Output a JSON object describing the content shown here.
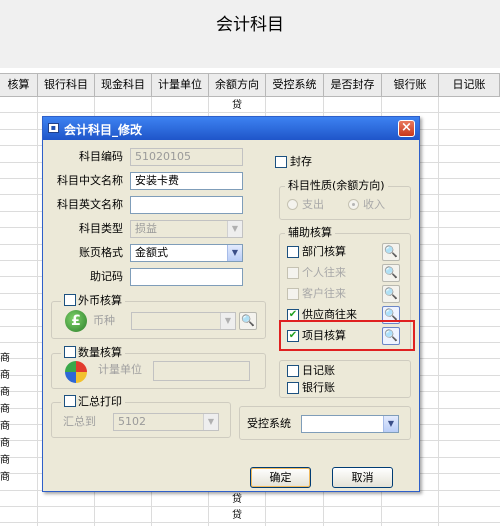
{
  "window": {
    "title": "会计科目"
  },
  "grid": {
    "headers": [
      "核算",
      "银行科目",
      "现金科目",
      "计量单位",
      "余额方向",
      "受控系统",
      "是否封存",
      "银行账",
      "日记账"
    ],
    "balance_direction_values": [
      "贷",
      "贷",
      "贷",
      "贷"
    ],
    "left_edge_chars": [
      "商",
      "商",
      "商",
      "商",
      "商",
      "商",
      "商",
      "商"
    ]
  },
  "dialog": {
    "title": "会计科目_修改",
    "close_symbol": "×",
    "fields": {
      "code_label": "科目编码",
      "code_value": "51020105",
      "cn_name_label": "科目中文名称",
      "cn_name_value": "安装卡费",
      "en_name_label": "科目英文名称",
      "en_name_value": "",
      "type_label": "科目类型",
      "type_value": "损益",
      "format_label": "账页格式",
      "format_value": "金额式",
      "mnemonic_label": "助记码",
      "mnemonic_value": ""
    },
    "seal": {
      "label": "封存",
      "checked": false
    },
    "balance_direction": {
      "caption": "科目性质(余额方向)",
      "options": [
        "支出",
        "收入"
      ],
      "selected": "收入"
    },
    "foreign_currency": {
      "caption": "外币核算",
      "currency_label": "币种",
      "currency_value": ""
    },
    "quantity": {
      "caption": "数量核算",
      "unit_label": "计量单位",
      "unit_value": ""
    },
    "summary_print": {
      "caption": "汇总打印",
      "to_label": "汇总到",
      "to_value": "5102"
    },
    "aux": {
      "caption": "辅助核算",
      "items": [
        {
          "label": "部门核算",
          "checked": false,
          "enabled": true
        },
        {
          "label": "个人往来",
          "checked": false,
          "enabled": false
        },
        {
          "label": "客户往来",
          "checked": false,
          "enabled": false
        },
        {
          "label": "供应商往来",
          "checked": true,
          "enabled": true
        },
        {
          "label": "项目核算",
          "checked": true,
          "enabled": true
        }
      ]
    },
    "journal": {
      "label": "日记账",
      "checked": false
    },
    "bank_book": {
      "label": "银行账",
      "checked": false
    },
    "controlled_system": {
      "label": "受控系统",
      "value": ""
    },
    "buttons": {
      "ok": "确定",
      "cancel": "取消"
    },
    "highlight_color": "#e02020"
  }
}
